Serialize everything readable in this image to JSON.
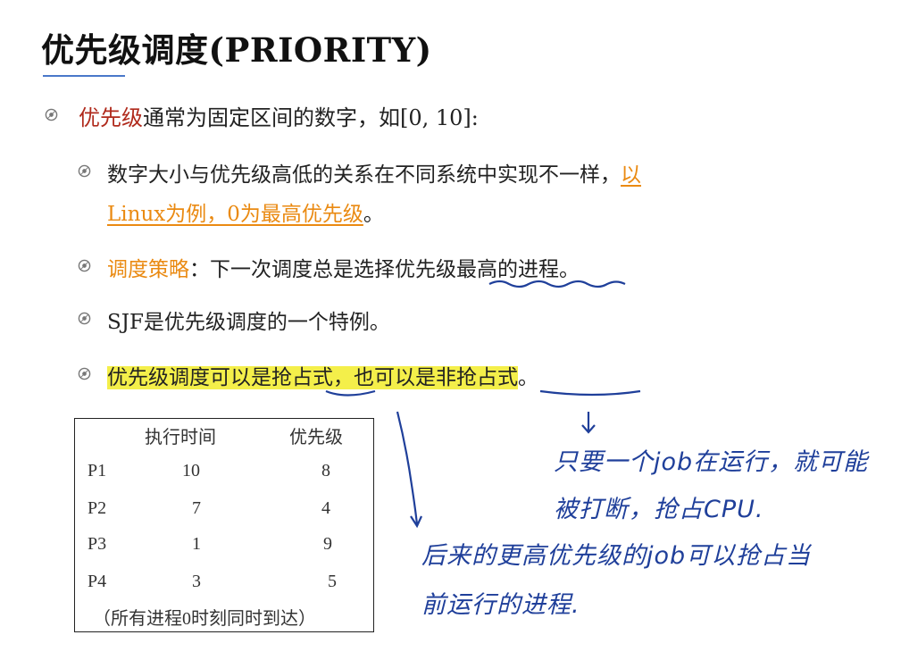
{
  "title": "优先级调度(PRIORITY)",
  "bullets": {
    "b1": {
      "keyword": "优先级",
      "rest": "通常为固定区间的数字，如[0, 10]:"
    },
    "b2": {
      "text": "数字大小与优先级高低的关系在不同系统中实现不一样，",
      "highlight_part1": "以",
      "highlight_part2": "Linux为例，0为最高优先级",
      "end": "。"
    },
    "b3": {
      "keyword": "调度策略",
      "rest_part1": "：下一次调度总是选择",
      "underlined": "优先级",
      "rest_part2": "最高的进程。"
    },
    "b4": {
      "text": "SJF是优先级调度的一个特例。"
    },
    "b5": {
      "part1": "优先级调度可以是",
      "u1": "抢占式",
      "part2": "，也可以是",
      "part3": "非",
      "u2": "抢占式",
      "end": "。"
    }
  },
  "table": {
    "headers": [
      "执行时间",
      "优先级"
    ],
    "rows": [
      {
        "proc": "P1",
        "time": "10",
        "priority": "8"
      },
      {
        "proc": "P2",
        "time": "7",
        "priority": "4"
      },
      {
        "proc": "P3",
        "time": "1",
        "priority": "9"
      },
      {
        "proc": "P4",
        "time": "3",
        "priority": "5"
      }
    ],
    "note": "（所有进程0时刻同时到达）"
  },
  "annotations": {
    "right_line1": "只要一个job在运行，就可能",
    "right_line2": "被打断，抢占CPU.",
    "bottom_line1": "后来的更高优先级的job可以抢占当",
    "bottom_line2": "前运行的进程."
  },
  "colors": {
    "keyword_red": "#b02a1c",
    "keyword_orange": "#ea8a12",
    "highlight": "#f4ef4a",
    "ink": "#1f3f9a",
    "rule": "#4a78c9"
  }
}
